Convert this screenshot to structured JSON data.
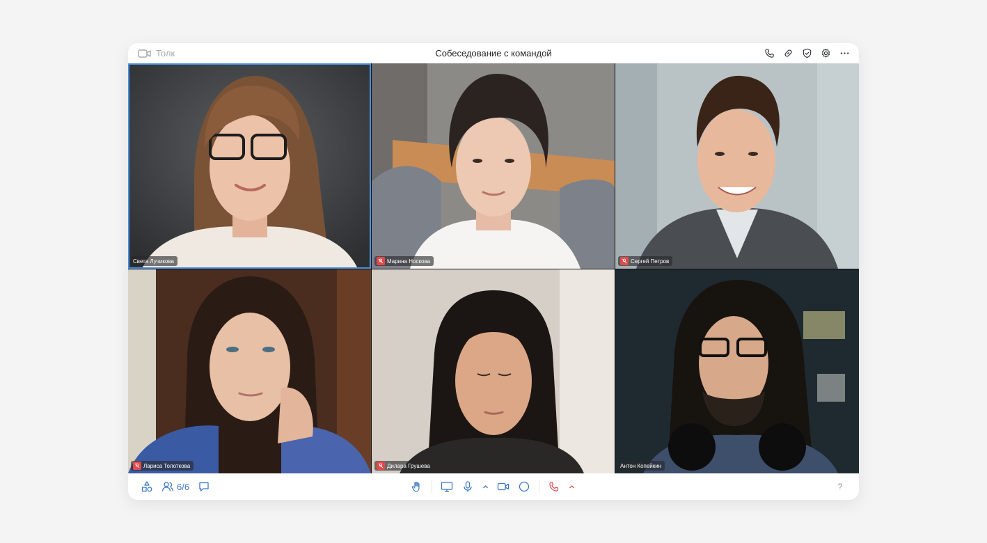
{
  "app": {
    "name": "Толк",
    "meeting_title": "Собеседование с командой"
  },
  "colors": {
    "accent": "#3a77c6",
    "active_border": "#4a8fe0",
    "muted_badge": "#e24a4a",
    "end_call": "#e24a4a"
  },
  "header_actions": [
    {
      "name": "phone-icon"
    },
    {
      "name": "link-icon"
    },
    {
      "name": "shield-check-icon"
    },
    {
      "name": "gear-icon"
    },
    {
      "name": "more-icon"
    }
  ],
  "participants": [
    {
      "name": "Света Лучикова",
      "muted": false,
      "active": true
    },
    {
      "name": "Марина Носкова",
      "muted": true,
      "active": false
    },
    {
      "name": "Сергей Петров",
      "muted": true,
      "active": false
    },
    {
      "name": "Лариса Толоткова",
      "muted": true,
      "active": false
    },
    {
      "name": "Дилара Грушева",
      "muted": true,
      "active": false
    },
    {
      "name": "Антон Копейкин",
      "muted": false,
      "active": false
    }
  ],
  "toolbar": {
    "participants_count": "6/6",
    "help_label": "?"
  }
}
